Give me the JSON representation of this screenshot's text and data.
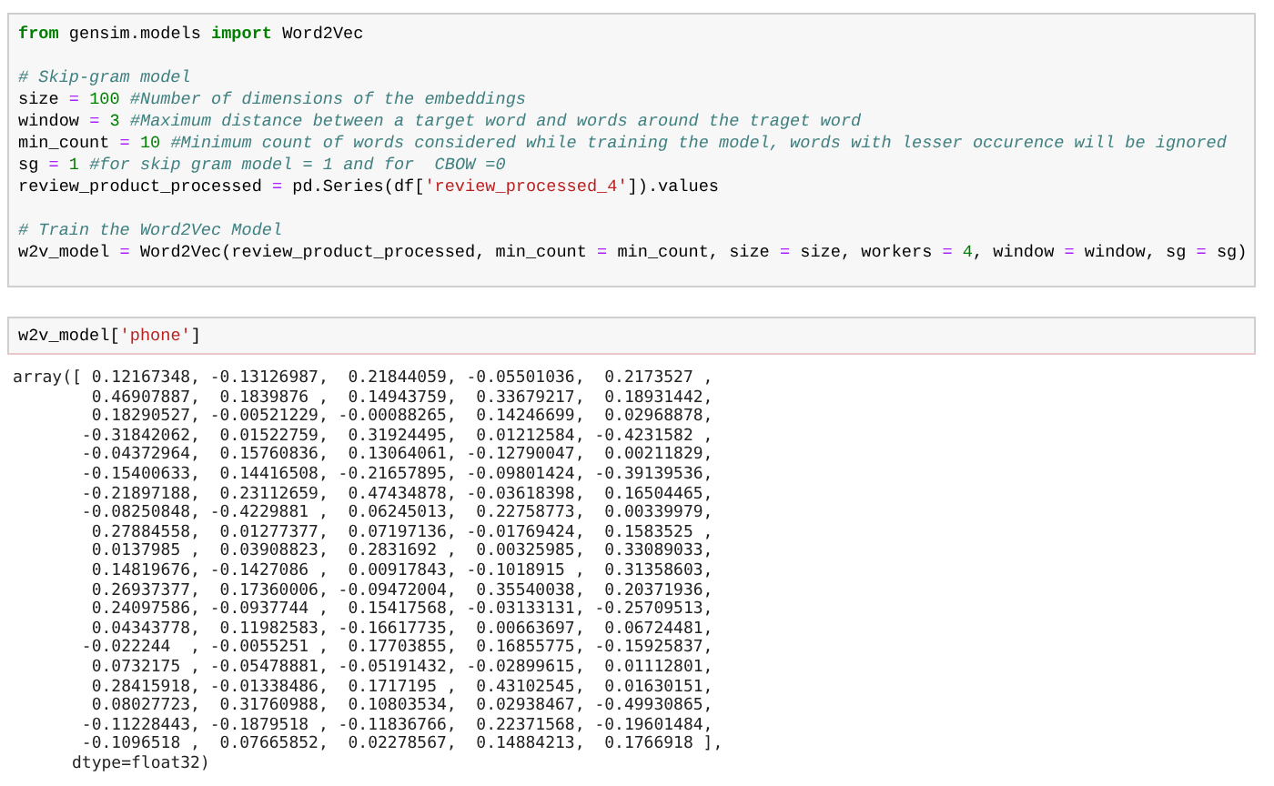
{
  "cells": [
    {
      "kind": "code",
      "blocks": [
        [
          [
            {
              "kind": "kw",
              "text": "from"
            },
            {
              "kind": "plain",
              "text": " gensim.models "
            },
            {
              "kind": "kw",
              "text": "import"
            },
            {
              "kind": "plain",
              "text": " Word2Vec"
            }
          ]
        ],
        [
          [
            {
              "kind": "comment",
              "text": "# Skip-gram model"
            }
          ],
          [
            {
              "kind": "plain",
              "text": "size "
            },
            {
              "kind": "op",
              "text": "="
            },
            {
              "kind": "num",
              "text": " 100"
            },
            {
              "kind": "comment",
              "text": " #Number of dimensions of the embeddings"
            }
          ],
          [
            {
              "kind": "plain",
              "text": "window "
            },
            {
              "kind": "op",
              "text": "="
            },
            {
              "kind": "num",
              "text": " 3"
            },
            {
              "kind": "comment",
              "text": " #Maximum distance between a target word and words around the traget word"
            }
          ],
          [
            {
              "kind": "plain",
              "text": "min_count "
            },
            {
              "kind": "op",
              "text": "="
            },
            {
              "kind": "num",
              "text": " 10"
            },
            {
              "kind": "comment",
              "text": " #Minimum count of words considered while training the model, words with lesser occurence will be ignored"
            }
          ],
          [
            {
              "kind": "plain",
              "text": "sg "
            },
            {
              "kind": "op",
              "text": "="
            },
            {
              "kind": "num",
              "text": " 1"
            },
            {
              "kind": "comment",
              "text": " #for skip gram model = 1 and for  CBOW =0"
            }
          ],
          [
            {
              "kind": "plain",
              "text": "review_product_processed "
            },
            {
              "kind": "op",
              "text": "="
            },
            {
              "kind": "plain",
              "text": " pd.Series(df["
            },
            {
              "kind": "str",
              "text": "'review_processed_4'"
            },
            {
              "kind": "plain",
              "text": "]).values"
            }
          ]
        ],
        [
          [
            {
              "kind": "comment",
              "text": "# Train the Word2Vec Model"
            }
          ],
          [
            {
              "kind": "plain",
              "text": "w2v_model "
            },
            {
              "kind": "op",
              "text": "="
            },
            {
              "kind": "plain",
              "text": " Word2Vec(review_product_processed, min_count "
            },
            {
              "kind": "op",
              "text": "="
            },
            {
              "kind": "plain",
              "text": " min_count, size "
            },
            {
              "kind": "op",
              "text": "="
            },
            {
              "kind": "plain",
              "text": " size, workers "
            },
            {
              "kind": "op",
              "text": "="
            },
            {
              "kind": "num",
              "text": " 4"
            },
            {
              "kind": "plain",
              "text": ", window "
            },
            {
              "kind": "op",
              "text": "="
            },
            {
              "kind": "plain",
              "text": " window, sg "
            },
            {
              "kind": "op",
              "text": "="
            },
            {
              "kind": "plain",
              "text": " sg)"
            }
          ]
        ]
      ]
    },
    {
      "kind": "code",
      "blocks": [
        [
          [
            {
              "kind": "plain",
              "text": "w2v_model["
            },
            {
              "kind": "str",
              "text": "'phone'"
            },
            {
              "kind": "plain",
              "text": "]"
            }
          ]
        ]
      ],
      "output": [
        "array([ 0.12167348, -0.13126987,  0.21844059, -0.05501036,  0.2173527 ,",
        "        0.46907887,  0.1839876 ,  0.14943759,  0.33679217,  0.18931442,",
        "        0.18290527, -0.00521229, -0.00088265,  0.14246699,  0.02968878,",
        "       -0.31842062,  0.01522759,  0.31924495,  0.01212584, -0.4231582 ,",
        "       -0.04372964,  0.15760836,  0.13064061, -0.12790047,  0.00211829,",
        "       -0.15400633,  0.14416508, -0.21657895, -0.09801424, -0.39139536,",
        "       -0.21897188,  0.23112659,  0.47434878, -0.03618398,  0.16504465,",
        "       -0.08250848, -0.4229881 ,  0.06245013,  0.22758773,  0.00339979,",
        "        0.27884558,  0.01277377,  0.07197136, -0.01769424,  0.1583525 ,",
        "        0.0137985 ,  0.03908823,  0.2831692 ,  0.00325985,  0.33089033,",
        "        0.14819676, -0.1427086 ,  0.00917843, -0.1018915 ,  0.31358603,",
        "        0.26937377,  0.17360006, -0.09472004,  0.35540038,  0.20371936,",
        "        0.24097586, -0.0937744 ,  0.15417568, -0.03133131, -0.25709513,",
        "        0.04343778,  0.11982583, -0.16617735,  0.00663697,  0.06724481,",
        "       -0.022244  , -0.0055251 ,  0.17703855,  0.16855775, -0.15925837,",
        "        0.0732175 , -0.05478881, -0.05191432, -0.02899615,  0.01112801,",
        "        0.28415918, -0.01338486,  0.1717195 ,  0.43102545,  0.01630151,",
        "        0.08027723,  0.31760988,  0.10803534,  0.02938467, -0.49930865,",
        "       -0.11228443, -0.1879518 , -0.11836766,  0.22371568, -0.19601484,",
        "       -0.1096518 ,  0.07665852,  0.02278567,  0.14884213,  0.1766918 ],",
        "      dtype=float32)"
      ]
    }
  ]
}
